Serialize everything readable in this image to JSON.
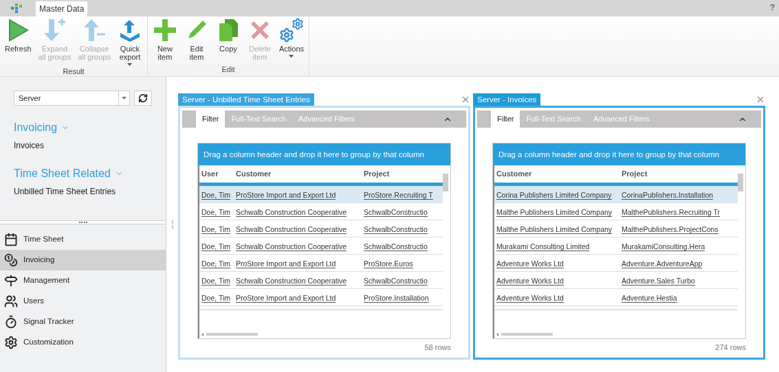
{
  "titlebar": {
    "tab": "Master Data",
    "help": "?"
  },
  "ribbon": {
    "groups": [
      {
        "label": "Result",
        "buttons": [
          {
            "kind": "refresh",
            "lines": [
              "Refresh"
            ],
            "disabled": false,
            "dropdown": false
          },
          {
            "kind": "expand",
            "lines": [
              "Expand",
              "all groups"
            ],
            "disabled": true,
            "dropdown": false
          },
          {
            "kind": "collapse",
            "lines": [
              "Collapse",
              "all groups"
            ],
            "disabled": true,
            "dropdown": false
          },
          {
            "kind": "export",
            "lines": [
              "Quick",
              "export"
            ],
            "disabled": false,
            "dropdown": true
          }
        ]
      },
      {
        "label": "Edit",
        "buttons": [
          {
            "kind": "new",
            "lines": [
              "New",
              "item"
            ],
            "disabled": false,
            "dropdown": false
          },
          {
            "kind": "edit",
            "lines": [
              "Edit",
              "item"
            ],
            "disabled": false,
            "dropdown": false
          },
          {
            "kind": "copy",
            "lines": [
              "Copy"
            ],
            "disabled": false,
            "dropdown": false
          },
          {
            "kind": "delete",
            "lines": [
              "Delete",
              "item"
            ],
            "disabled": true,
            "dropdown": false
          },
          {
            "kind": "actions",
            "lines": [
              "Actions"
            ],
            "disabled": false,
            "dropdown": true
          }
        ]
      }
    ]
  },
  "sidebar": {
    "server": {
      "value": "Server"
    },
    "sections": [
      {
        "title": "Invoicing",
        "items": [
          "Invoices"
        ]
      },
      {
        "title": "Time Sheet Related",
        "items": [
          "Unbilled Time Sheet Entries"
        ]
      }
    ],
    "nav": [
      {
        "kind": "calendar",
        "label": "Time Sheet",
        "selected": false
      },
      {
        "kind": "invoicing",
        "label": "Invoicing",
        "selected": true
      },
      {
        "kind": "signpost",
        "label": "Management",
        "selected": false
      },
      {
        "kind": "users",
        "label": "Users",
        "selected": false
      },
      {
        "kind": "stopwatch",
        "label": "Signal Tracker",
        "selected": false
      },
      {
        "kind": "gear",
        "label": "Customization",
        "selected": false
      }
    ]
  },
  "panels": [
    {
      "title": "Server - Unbilled Time Sheet Entries",
      "active": false,
      "tabs": [
        {
          "label": "Filter",
          "selected": true
        },
        {
          "label": "Full-Text Search",
          "selected": false
        },
        {
          "label": "Advanced Filters",
          "selected": false
        }
      ],
      "group_hint": "Drag a column header and drop it here to group by that column",
      "columns": [
        "User",
        "Customer",
        "Project"
      ],
      "rows": [
        {
          "selected": true,
          "cells": [
            "Doe, Tim",
            "ProStore Import and Export Ltd",
            "ProStore.Recruiting T"
          ]
        },
        {
          "selected": false,
          "cells": [
            "Doe, Tim",
            "Schwalb Construction Cooperative",
            "SchwalbConstructio"
          ]
        },
        {
          "selected": false,
          "cells": [
            "Doe, Tim",
            "Schwalb Construction Cooperative",
            "SchwalbConstructio"
          ]
        },
        {
          "selected": false,
          "cells": [
            "Doe, Tim",
            "Schwalb Construction Cooperative",
            "SchwalbConstructio"
          ]
        },
        {
          "selected": false,
          "cells": [
            "Doe, Tim",
            "ProStore Import and Export Ltd",
            "ProStore.Euros"
          ]
        },
        {
          "selected": false,
          "cells": [
            "Doe, Tim",
            "Schwalb Construction Cooperative",
            "SchwalbConstructio"
          ]
        },
        {
          "selected": false,
          "cells": [
            "Doe, Tim",
            "ProStore Import and Export Ltd",
            "ProStore.Installation"
          ]
        }
      ],
      "row_count": "58 rows"
    },
    {
      "title": "Server - Invoices",
      "active": true,
      "tabs": [
        {
          "label": "Filter",
          "selected": true
        },
        {
          "label": "Full-Text Search",
          "selected": false
        },
        {
          "label": "Advanced Filters",
          "selected": false
        }
      ],
      "group_hint": "Drag a column header and drop it here to group by that column",
      "columns": [
        "Customer",
        "Project"
      ],
      "rows": [
        {
          "selected": true,
          "cells": [
            "Corina Publishers Limited Company",
            "CorinaPublishers.Installation"
          ]
        },
        {
          "selected": false,
          "cells": [
            "Malthe Publishers Limited Company",
            "MalthePublishers.Recruiting Tr"
          ]
        },
        {
          "selected": false,
          "cells": [
            "Malthe Publishers Limited Company",
            "MalthePublishers.ProjectCons"
          ]
        },
        {
          "selected": false,
          "cells": [
            "Murakami Consulting Limited",
            "MurakamiConsulting.Hera"
          ]
        },
        {
          "selected": false,
          "cells": [
            "Adventure Works Ltd",
            "Adventure.AdventureApp"
          ]
        },
        {
          "selected": false,
          "cells": [
            "Adventure Works Ltd",
            "Adventure.Sales Turbo"
          ]
        },
        {
          "selected": false,
          "cells": [
            "Adventure Works Ltd",
            "Adventure.Hestia"
          ]
        }
      ],
      "row_count": "274 rows"
    }
  ]
}
